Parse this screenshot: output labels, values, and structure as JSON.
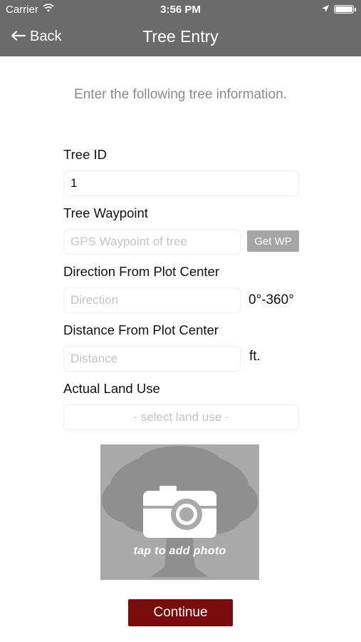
{
  "status_bar": {
    "carrier": "Carrier",
    "time": "3:56 PM",
    "icons": [
      "wifi-icon",
      "location-arrow-icon",
      "battery-icon"
    ]
  },
  "nav": {
    "back_label": "Back",
    "title": "Tree Entry"
  },
  "intro": "Enter the following tree information.",
  "form": {
    "tree_id": {
      "label": "Tree ID",
      "value": "1"
    },
    "waypoint": {
      "label": "Tree Waypoint",
      "placeholder": "GPS Waypoint of tree",
      "button": "Get WP"
    },
    "direction": {
      "label": "Direction From Plot Center",
      "placeholder": "Direction",
      "unit": "0°-360°"
    },
    "distance": {
      "label": "Distance From Plot Center",
      "placeholder": "Distance",
      "unit": "ft."
    },
    "land_use": {
      "label": "Actual Land Use",
      "selected": "- select land use -"
    }
  },
  "photo": {
    "caption": "tap to add photo"
  },
  "continue_label": "Continue",
  "colors": {
    "nav_bar": "#6b6b6b",
    "continue_button": "#7a0c0c",
    "get_wp_button": "#a6a6a6",
    "photo_placeholder": "#a9a9a9"
  }
}
